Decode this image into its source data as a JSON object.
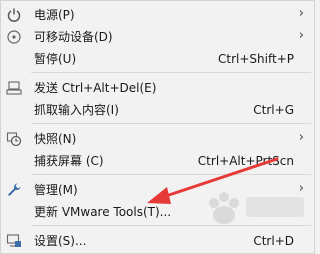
{
  "menu": {
    "items": [
      {
        "icon": "power-icon",
        "label": "电源(P)",
        "shortcut": "",
        "submenu": true
      },
      {
        "icon": "cd-disc-icon",
        "label": "可移动设备(D)",
        "shortcut": "",
        "submenu": true
      },
      {
        "icon": "",
        "label": "暂停(U)",
        "shortcut": "Ctrl+Shift+P",
        "submenu": false
      },
      {
        "icon": "keyboard-send-icon",
        "label": "发送 Ctrl+Alt+Del(E)",
        "shortcut": "",
        "submenu": false
      },
      {
        "icon": "",
        "label": "抓取输入内容(I)",
        "shortcut": "Ctrl+G",
        "submenu": false
      },
      {
        "icon": "snapshot-clock-icon",
        "label": "快照(N)",
        "shortcut": "",
        "submenu": true
      },
      {
        "icon": "",
        "label": "捕获屏幕 (C)",
        "shortcut": "Ctrl+Alt+PrtScn",
        "submenu": false
      },
      {
        "icon": "wrench-icon",
        "label": "管理(M)",
        "shortcut": "",
        "submenu": true
      },
      {
        "icon": "",
        "label": "更新 VMware Tools(T)...",
        "shortcut": "",
        "submenu": false
      },
      {
        "icon": "settings-monitor-icon",
        "label": "设置(S)...",
        "shortcut": "Ctrl+D",
        "submenu": false
      }
    ],
    "submenu_arrow": "›"
  },
  "colors": {
    "annotation_arrow": "#e53935",
    "menu_background": "#f2f2f2"
  }
}
